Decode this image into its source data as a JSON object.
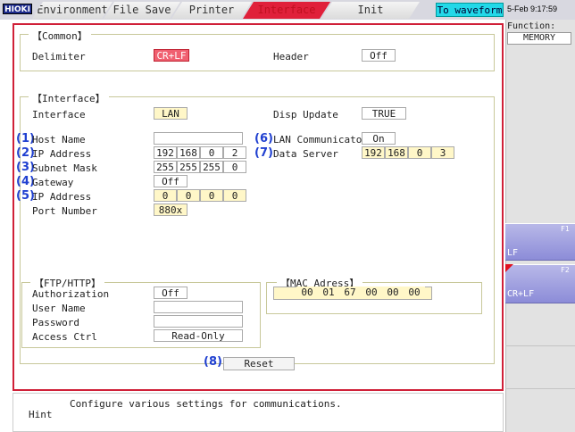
{
  "topbar": {
    "logo": "HIOKI",
    "tabs": [
      "Environment",
      "File Save",
      "Printer",
      "Interface",
      "Init"
    ],
    "active_tab": "Interface",
    "to_waveform": "To waveform",
    "clock": "5-Feb 9:17:59"
  },
  "common": {
    "title": "【Common】",
    "delimiter_label": "Delimiter",
    "delimiter_value": "CR+LF",
    "header_label": "Header",
    "header_value": "Off"
  },
  "interface": {
    "title": "【Interface】",
    "interface_label": "Interface",
    "interface_value": "LAN",
    "disp_update_label": "Disp Update",
    "disp_update_value": "TRUE",
    "host_name_label": "Host Name",
    "host_name_value": "",
    "ip_label": "IP Address",
    "ip": [
      "192",
      "168",
      "0",
      "2"
    ],
    "subnet_label": "Subnet Mask",
    "subnet": [
      "255",
      "255",
      "255",
      "0"
    ],
    "gateway_label": "Gateway",
    "gateway_value": "Off",
    "gw_ip_label": "IP Address",
    "gw_ip": [
      "0",
      "0",
      "0",
      "0"
    ],
    "port_label": "Port Number",
    "port_value": "880x",
    "lan_comm_label": "LAN Communicator",
    "lan_comm_value": "On",
    "data_server_label": "Data Server",
    "data_server": [
      "192",
      "168",
      "0",
      "3"
    ]
  },
  "markers": [
    "(1)",
    "(2)",
    "(3)",
    "(4)",
    "(5)",
    "(6)",
    "(7)",
    "(8)"
  ],
  "ftp": {
    "title": "【FTP/HTTP】",
    "auth_label": "Authorization",
    "auth_value": "Off",
    "user_label": "User Name",
    "user_value": "",
    "pass_label": "Password",
    "pass_value": "",
    "access_label": "Access Ctrl",
    "access_value": "Read-Only"
  },
  "mac": {
    "title": "【MAC Adress】",
    "octets": [
      "00",
      "01",
      "67",
      "00",
      "00",
      "00"
    ]
  },
  "reset_label": "Reset",
  "hint": {
    "label": "Hint",
    "text": "Configure various settings for communications."
  },
  "side": {
    "function_label": "Function:",
    "function_value": "MEMORY",
    "f1_key": "F1",
    "f1_label": "LF",
    "f2_key": "F2",
    "f2_label": "CR+LF"
  }
}
